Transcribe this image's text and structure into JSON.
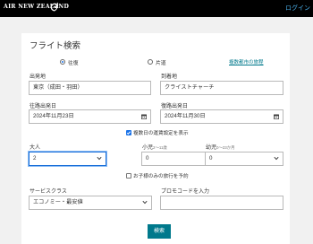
{
  "header": {
    "logo_text": "AIR NEW ZEALAND",
    "login_label": "ログイン"
  },
  "form": {
    "title": "フライト検索",
    "trip_type": {
      "round_trip_label": "往復",
      "one_way_label": "片道",
      "selected": "round_trip"
    },
    "multi_city_link": "複数都市の旅程",
    "origin": {
      "label": "出発地",
      "value": "東京（成田・羽田）"
    },
    "destination": {
      "label": "到着地",
      "value": "クライストチャーチ"
    },
    "depart_date": {
      "label": "往路出発日",
      "value": "2024年11月23日"
    },
    "return_date": {
      "label": "復路出発日",
      "value": "2024年11月30日"
    },
    "show_fares_checkbox": {
      "label": "複数日の運賃設定を表示",
      "checked": true
    },
    "adults": {
      "label": "大人",
      "value": "2"
    },
    "children": {
      "label": "小児",
      "sub": "2〜11歳",
      "value": "0"
    },
    "infants": {
      "label": "幼児",
      "sub": "0〜23か月",
      "value": "0"
    },
    "children_only_checkbox": {
      "label": "お子様のみの旅行を予約",
      "checked": false
    },
    "service_class": {
      "label": "サービスクラス",
      "value": "エコノミー・最安値"
    },
    "promo_code": {
      "label": "プロモコードを入力",
      "value": ""
    },
    "search_button": "検索"
  }
}
